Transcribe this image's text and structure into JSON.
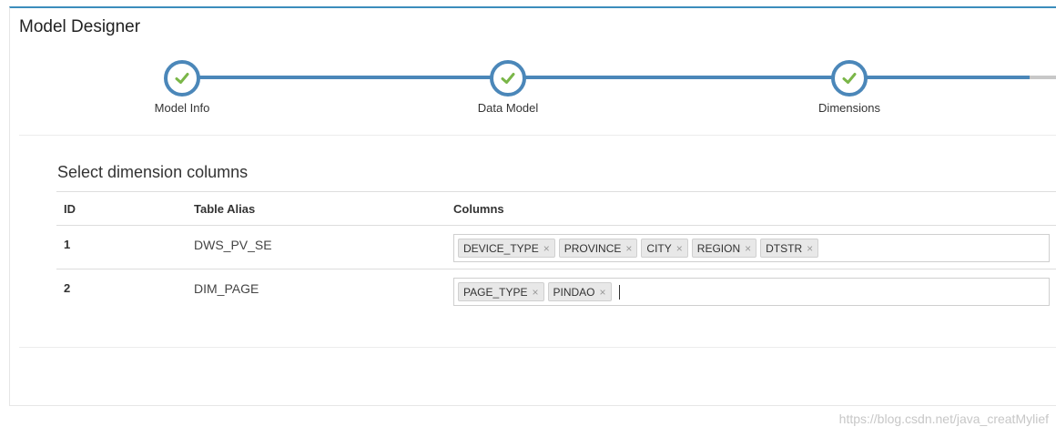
{
  "panel": {
    "title": "Model Designer"
  },
  "wizard": {
    "steps": [
      {
        "label": "Model Info",
        "status": "done"
      },
      {
        "label": "Data Model",
        "status": "done"
      },
      {
        "label": "Dimensions",
        "status": "done"
      }
    ],
    "colors": {
      "active": "#4b87b9",
      "check": "#7ab648",
      "pending": "#c8c8c8"
    }
  },
  "section": {
    "title": "Select dimension columns",
    "headers": {
      "id": "ID",
      "alias": "Table Alias",
      "columns": "Columns"
    },
    "rows": [
      {
        "id": "1",
        "alias": "DWS_PV_SE",
        "columns": [
          "DEVICE_TYPE",
          "PROVINCE",
          "CITY",
          "REGION",
          "DTSTR"
        ]
      },
      {
        "id": "2",
        "alias": "DIM_PAGE",
        "columns": [
          "PAGE_TYPE",
          "PINDAO"
        ]
      }
    ]
  },
  "tag_remove_symbol": "×",
  "watermark": "https://blog.csdn.net/java_creatMylief"
}
